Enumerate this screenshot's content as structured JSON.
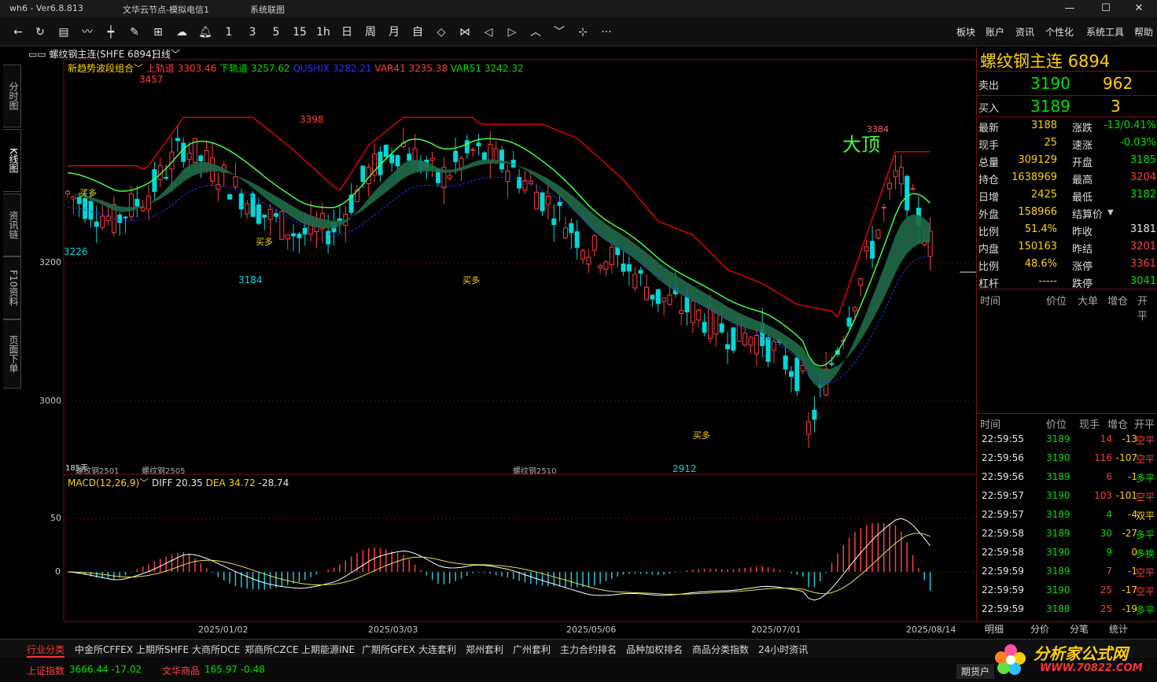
{
  "titlebar": {
    "app": "wh6  -  Ver6.8.813",
    "node": "文华云节点-模拟电信1",
    "menu": "系统联图",
    "min": "—",
    "max": "☐",
    "close": "✕"
  },
  "toolbar": {
    "icons": [
      "back-icon",
      "refresh-icon",
      "table-icon",
      "line-chart-icon",
      "candle-icon",
      "draw-icon",
      "grid-icon",
      "cloud-icon",
      "bell-icon"
    ],
    "periods": [
      "1",
      "3",
      "5",
      "15",
      "1h",
      "日",
      "周",
      "月",
      "自"
    ],
    "right_menu": [
      "板块",
      "账户",
      "资讯",
      "个性化",
      "系统工具",
      "帮助"
    ],
    "more": "···"
  },
  "side_tabs": [
    "分时图",
    "K线图",
    "资讯链",
    "F10资料",
    "页面下单"
  ],
  "chart": {
    "symbol": "螺纹钢主连(SHFE 6894)",
    "period": "日线",
    "indicator_name": "新趋势波段组合",
    "upper_label": "上轨道",
    "upper_value": "3303.46",
    "lower_label": "下轨道",
    "lower_value": "3257.62",
    "qushix_label": "QUSHIX",
    "qushix_value": "3282.21",
    "var41_label": "VAR41",
    "var41_value": "3235.38",
    "var51_label": "VAR51",
    "var51_value": "3242.32",
    "y_ticks": [
      "3200",
      "3000"
    ],
    "annotations": {
      "high1": "3457",
      "high2": "3398",
      "low1": "3226",
      "low2": "3184",
      "low3": "2912",
      "top_mark": "大顶",
      "buy": "买多",
      "peak": "3384",
      "days": "185天"
    },
    "contracts": [
      "螺纹钢2501",
      "螺纹钢2505",
      "螺纹钢2510"
    ],
    "macd_name": "MACD(12,26,9)",
    "diff_label": "DIFF",
    "diff_value": "20.35",
    "dea_label": "DEA",
    "dea_value": "34.72",
    "macd_value": "-28.74",
    "macd_ticks": [
      "50",
      "0"
    ],
    "dates": [
      "2025/01/02",
      "2025/03/03",
      "2025/05/06",
      "2025/07/01",
      "2025/08/14"
    ]
  },
  "quote": {
    "name": "螺纹钢主连",
    "code": "6894",
    "sell_label": "卖出",
    "sell_price": "3190",
    "sell_vol": "962",
    "buy_label": "买入",
    "buy_price": "3189",
    "buy_vol": "3",
    "rows": [
      {
        "l1": "最新",
        "v1": "3188",
        "l2": "涨跌",
        "v2": "-13/0.41%"
      },
      {
        "l1": "现手",
        "v1": "25",
        "l2": "速涨",
        "v2": "-0.03%"
      },
      {
        "l1": "总量",
        "v1": "309129",
        "l2": "开盘",
        "v2": "3185"
      },
      {
        "l1": "持仓",
        "v1": "1638969",
        "l2": "最高",
        "v2": "3204"
      },
      {
        "l1": "日增",
        "v1": "2425",
        "l2": "最低",
        "v2": "3182"
      },
      {
        "l1": "外盘",
        "v1": "158966",
        "l2": "结算价",
        "v2": ""
      },
      {
        "l1": "比例",
        "v1": "51.4%",
        "l2": "昨收",
        "v2": "3181"
      },
      {
        "l1": "内盘",
        "v1": "150163",
        "l2": "昨结",
        "v2": "3201"
      },
      {
        "l1": "比例",
        "v1": "48.6%",
        "l2": "涨停",
        "v2": "3361"
      },
      {
        "l1": "杠杆",
        "v1": "-----",
        "l2": "跌停",
        "v2": "3041"
      }
    ],
    "big_header": [
      "时间",
      "价位",
      "大单",
      "增仓",
      "开平"
    ],
    "tick_header": [
      "时间",
      "价位",
      "现手",
      "增仓",
      "开平"
    ],
    "ticks": [
      {
        "t": "22:59:55",
        "p": "3189",
        "v": "14",
        "d": "-13",
        "k": "空平"
      },
      {
        "t": "22:59:56",
        "p": "3190",
        "v": "116",
        "d": "-107",
        "k": "空平"
      },
      {
        "t": "22:59:56",
        "p": "3189",
        "v": "6",
        "d": "-1",
        "k": "多平"
      },
      {
        "t": "22:59:57",
        "p": "3190",
        "v": "103",
        "d": "-101",
        "k": "空平"
      },
      {
        "t": "22:59:57",
        "p": "3189",
        "v": "4",
        "d": "-4",
        "k": "双平"
      },
      {
        "t": "22:59:58",
        "p": "3189",
        "v": "30",
        "d": "-27",
        "k": "多平"
      },
      {
        "t": "22:59:58",
        "p": "3190",
        "v": "9",
        "d": "0",
        "k": "多换"
      },
      {
        "t": "22:59:59",
        "p": "3189",
        "v": "7",
        "d": "-1",
        "k": "空平"
      },
      {
        "t": "22:59:59",
        "p": "3190",
        "v": "25",
        "d": "-17",
        "k": "空平"
      },
      {
        "t": "22:59:59",
        "p": "3188",
        "v": "25",
        "d": "-19",
        "k": "多平"
      }
    ],
    "sub_tabs": [
      "明细",
      "分价",
      "分笔",
      "统计"
    ]
  },
  "bottom_tabs": [
    "行业分类",
    "中金所CFFEX",
    "上期所SHFE",
    "大商所DCE",
    "郑商所CZCE",
    "上期能源INE",
    "广期所GFEX",
    "大连套利",
    "郑州套利",
    "广州套利",
    "主力合约排名",
    "品种加权排名",
    "商品分类指数",
    "24小时资讯"
  ],
  "status": {
    "idx1_name": "上证指数",
    "idx1_value": "3666.44 -17.02",
    "idx2_name": "文华商品",
    "idx2_value": "165.97 -0.48",
    "right_btn": "期货户",
    "logo_text": "分析家公式网",
    "logo_url": "WWW.70822.COM"
  },
  "colors": {
    "up": "#ff3b3b",
    "down": "#00d8d8",
    "upper": "#e00000",
    "green": "#40ff40",
    "band_up": "#c04040",
    "band_down": "#207050"
  }
}
